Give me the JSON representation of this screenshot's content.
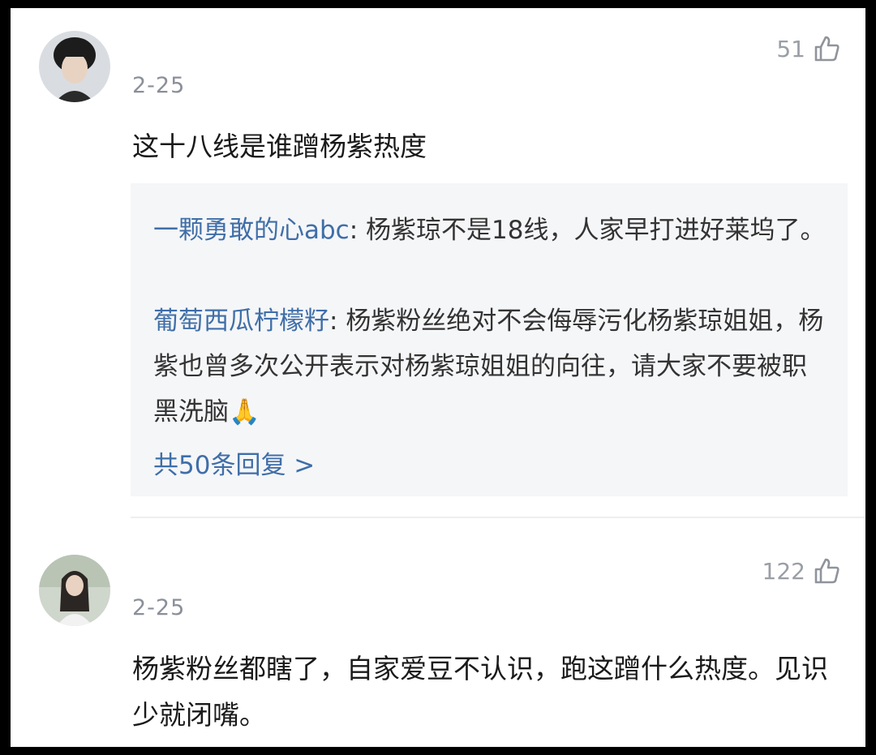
{
  "comments": [
    {
      "date": "2-25",
      "likes": "51",
      "text": "这十八线是谁蹭杨紫热度",
      "replies": [
        {
          "author": "一颗勇敢的心abc",
          "separator": ": ",
          "text": "杨紫琼不是18线，人家早打进好莱坞了。"
        },
        {
          "author": "葡萄西瓜柠檬籽",
          "separator": ": ",
          "text": "杨紫粉丝绝对不会侮辱污化杨紫琼姐姐，杨紫也曾多次公开表示对杨紫琼姐姐的向往，请大家不要被职黑洗脑🙏"
        }
      ],
      "more_replies": "共50条回复 >"
    },
    {
      "date": "2-25",
      "likes": "122",
      "text": "杨紫粉丝都瞎了，自家爱豆不认识，跑这蹭什么热度。见识少就闭嘴。"
    }
  ],
  "colors": {
    "link_blue": "#3f6ea8",
    "meta_gray": "#8a8f99",
    "reply_bg": "#f5f6f8"
  },
  "icons": {
    "like": "thumbs-up-icon"
  }
}
